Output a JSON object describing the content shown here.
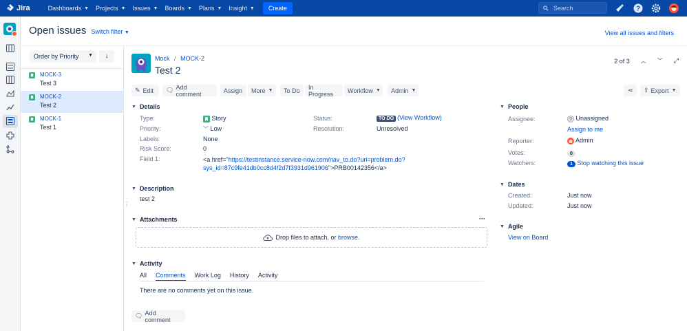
{
  "topbar": {
    "logo_text": "Jira",
    "nav": [
      "Dashboards",
      "Projects",
      "Issues",
      "Boards",
      "Plans",
      "Insight"
    ],
    "create_label": "Create",
    "search_placeholder": "Search",
    "icons": [
      "notification-icon",
      "help-icon",
      "settings-icon",
      "profile-avatar-icon"
    ],
    "brand_color": "#0747A6"
  },
  "sidebar": {
    "icons": [
      "project-avatar-icon",
      "roadmap-icon",
      "backlog-icon",
      "board-icon",
      "releases-icon",
      "reports-icon",
      "issues-icon",
      "components-icon",
      "code-icon"
    ]
  },
  "header": {
    "title": "Open issues",
    "switch_filter": "Switch filter",
    "view_all": "View all issues and filters"
  },
  "list": {
    "order_label": "Order by Priority",
    "items": [
      {
        "key": "MOCK-3",
        "summary": "Test 3"
      },
      {
        "key": "MOCK-2",
        "summary": "Test 2"
      },
      {
        "key": "MOCK-1",
        "summary": "Test 1"
      }
    ],
    "selected_index": 1
  },
  "issue": {
    "project": "Mock",
    "key": "MOCK-2",
    "title": "Test 2",
    "pager": "2 of 3"
  },
  "toolbar": {
    "edit": "Edit",
    "add_comment": "Add comment",
    "assign": "Assign",
    "more": "More",
    "to_do": "To Do",
    "in_progress": "In Progress",
    "workflow": "Workflow",
    "admin": "Admin",
    "export": "Export"
  },
  "details": {
    "heading": "Details",
    "type_label": "Type:",
    "type_value": "Story",
    "priority_label": "Priority:",
    "priority_value": "Low",
    "labels_label": "Labels:",
    "labels_value": "None",
    "risk_label": "Risk Score:",
    "risk_value": "0",
    "field1_label": "Field 1:",
    "field1_pre": "<a href=\"",
    "field1_link_line1": "https://testinstance.service-now.com/nav_to.do?uri=problem.do?",
    "field1_link_line2": "sys_id=87c9fe41db0cc8d4f2d7f3931d961906",
    "field1_post": "\">PRB00142356</a>",
    "status_label": "Status:",
    "status_lozenge": "TO DO",
    "status_view_workflow": "(View Workflow)",
    "resolution_label": "Resolution:",
    "resolution_value": "Unresolved"
  },
  "description": {
    "heading": "Description",
    "text": "test 2"
  },
  "attachments": {
    "heading": "Attachments",
    "more": "···",
    "drop_text": "Drop files to attach, or",
    "browse": "browse."
  },
  "activity": {
    "heading": "Activity",
    "tabs": [
      "All",
      "Comments",
      "Work Log",
      "History",
      "Activity"
    ],
    "active_tab": 1,
    "empty_text": "There are no comments yet on this issue.",
    "add_comment": "Add comment"
  },
  "people": {
    "heading": "People",
    "assignee_label": "Assignee:",
    "assignee_value": "Unassigned",
    "assign_to_me": "Assign to me",
    "reporter_label": "Reporter:",
    "reporter_value": "Admin",
    "votes_label": "Votes:",
    "votes_value": "0",
    "watchers_label": "Watchers:",
    "watchers_count": "1",
    "watchers_action": "Stop watching this issue"
  },
  "dates": {
    "heading": "Dates",
    "created_label": "Created:",
    "created_value": "Just now",
    "updated_label": "Updated:",
    "updated_value": "Just now"
  },
  "agile": {
    "heading": "Agile",
    "view_on_board": "View on Board"
  }
}
